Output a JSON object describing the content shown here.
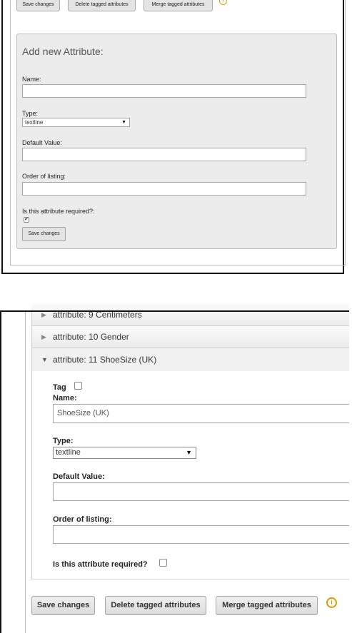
{
  "top": {
    "buttons": {
      "save": "Save changes",
      "delete": "Delete tagged attributes",
      "merge": "Merge tagged attributes"
    },
    "add_form": {
      "title": "Add new Attribute:",
      "name_label": "Name:",
      "type_label": "Type:",
      "type_value": "textline",
      "default_label": "Default Value:",
      "order_label": "Order of listing:",
      "required_label": "Is this attribute required?:",
      "required_checked": true,
      "save": "Save changes"
    }
  },
  "bottom": {
    "accordion": [
      {
        "label": "attribute: 9 Centimeters",
        "expanded": false
      },
      {
        "label": "attribute: 10 Gender",
        "expanded": false
      },
      {
        "label": "attribute: 11 ShoeSize (UK)",
        "expanded": true
      }
    ],
    "edit_form": {
      "tag_label": "Tag",
      "name_label": "Name:",
      "name_value": "ShoeSize (UK)",
      "type_label": "Type:",
      "type_value": "textline",
      "default_label": "Default Value:",
      "default_value": "",
      "order_label": "Order of listing:",
      "order_value": "",
      "required_label": "Is this attribute required?",
      "required_checked": false
    },
    "buttons": {
      "save": "Save changes",
      "delete": "Delete tagged attributes",
      "merge": "Merge tagged attributes"
    },
    "info_icon": "warning-info-icon"
  },
  "colors": {
    "warning": "#e09a00",
    "panel_bg": "#ececec",
    "frame": "#111111"
  }
}
